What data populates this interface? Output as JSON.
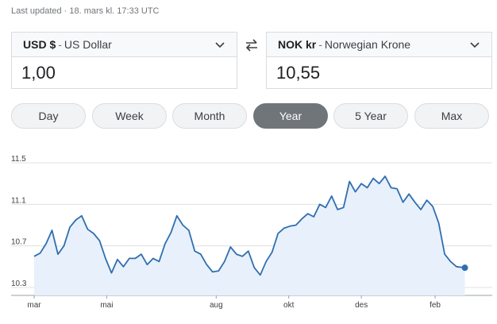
{
  "header": {
    "last_updated": "Last updated · 18. mars kl. 17:33 UTC"
  },
  "from": {
    "code": "USD $",
    "name": "US Dollar",
    "value": "1,00"
  },
  "to": {
    "code": "NOK kr",
    "name": "Norwegian Krone",
    "value": "10,55"
  },
  "icons": {
    "swap": "swap-arrows-icon",
    "dropdown": "chevron-down-icon"
  },
  "tabs": [
    {
      "label": "Day",
      "active": false
    },
    {
      "label": "Week",
      "active": false
    },
    {
      "label": "Month",
      "active": false
    },
    {
      "label": "Year",
      "active": true
    },
    {
      "label": "5 Year",
      "active": false
    },
    {
      "label": "Max",
      "active": false
    }
  ],
  "colors": {
    "line": "#2f6fb0",
    "fill": "#e8f0fb",
    "grid": "#e0e0e0",
    "active_tab": "#70757a"
  },
  "chart_data": {
    "type": "line",
    "y_ticks": [
      "11.5",
      "11.1",
      "10.7",
      "10.3"
    ],
    "y_tick_values": [
      11.5,
      11.1,
      10.7,
      10.3
    ],
    "ylim": [
      10.3,
      11.5
    ],
    "x_ticks": [
      "mar",
      "mai",
      "aug",
      "okt",
      "des",
      "feb"
    ],
    "x_tick_positions": [
      0,
      61,
      153,
      214,
      275,
      337
    ],
    "xlim": [
      0,
      385
    ],
    "grid": true,
    "series": [
      {
        "x": [
          0,
          5,
          10,
          15,
          20,
          25,
          30,
          35,
          40,
          45,
          50,
          55,
          60,
          65,
          70,
          75,
          80,
          85,
          90,
          95,
          100,
          105,
          110,
          115,
          120,
          125,
          130,
          135,
          140,
          145,
          150,
          155,
          160,
          165,
          170,
          175,
          180,
          185,
          190,
          195,
          200,
          205,
          210,
          215,
          220,
          225,
          230,
          235,
          240,
          245,
          250,
          255,
          260,
          265,
          270,
          275,
          280,
          285,
          290,
          295,
          300,
          305,
          310,
          315,
          320,
          325,
          330,
          335,
          340,
          345,
          350,
          355,
          362
        ],
        "values": [
          10.6,
          10.63,
          10.72,
          10.85,
          10.62,
          10.7,
          10.88,
          10.95,
          10.99,
          10.86,
          10.82,
          10.75,
          10.58,
          10.44,
          10.57,
          10.5,
          10.58,
          10.58,
          10.62,
          10.52,
          10.58,
          10.55,
          10.72,
          10.83,
          10.99,
          10.9,
          10.85,
          10.65,
          10.62,
          10.52,
          10.45,
          10.46,
          10.55,
          10.69,
          10.62,
          10.6,
          10.65,
          10.49,
          10.42,
          10.55,
          10.64,
          10.82,
          10.87,
          10.89,
          10.9,
          10.96,
          11.01,
          10.98,
          11.1,
          11.07,
          11.18,
          11.05,
          11.07,
          11.32,
          11.22,
          11.3,
          11.26,
          11.35,
          11.3,
          11.37,
          11.26,
          11.25,
          11.12,
          11.2,
          11.12,
          11.05,
          11.14,
          11.08,
          10.92,
          10.62,
          10.55,
          10.5,
          10.49
        ]
      }
    ]
  }
}
